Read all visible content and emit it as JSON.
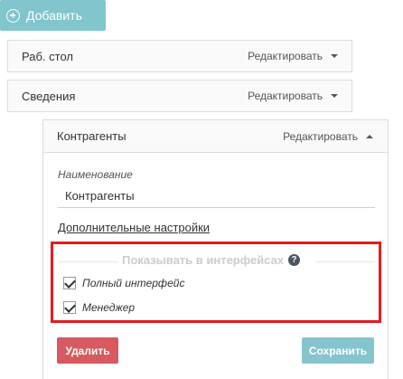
{
  "toolbar": {
    "add_label": "Добавить",
    "add_icon": "plus-circle-icon"
  },
  "items": [
    {
      "label": "Раб. стол",
      "edit_label": "Редактировать"
    },
    {
      "label": "Сведения",
      "edit_label": "Редактировать"
    }
  ],
  "panel": {
    "title": "Контрагенты",
    "edit_label": "Редактировать",
    "name_label": "Наименование",
    "name_value": "Контрагенты",
    "advanced_link": "Дополнительные настройки",
    "show_section": {
      "title": "Показывать в интерфейсах",
      "help_icon": "question-circle-icon",
      "options": [
        {
          "label": "Полный интерфейс",
          "checked": true
        },
        {
          "label": "Менеджер",
          "checked": true
        }
      ]
    },
    "delete_label": "Удалить",
    "save_label": "Сохранить"
  },
  "colors": {
    "accent": "#80c6cc",
    "danger": "#d65a5f",
    "highlight_border": "#e31b23"
  }
}
